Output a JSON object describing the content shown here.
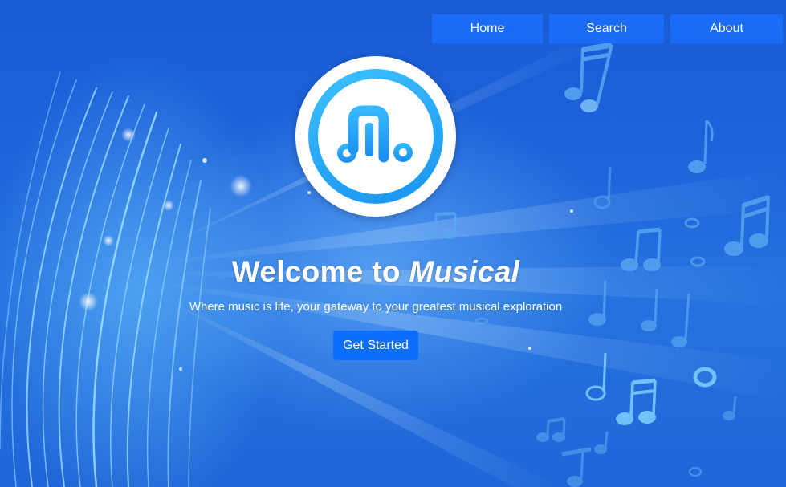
{
  "nav": {
    "items": [
      {
        "label": "Home"
      },
      {
        "label": "Search"
      },
      {
        "label": "About"
      }
    ]
  },
  "hero": {
    "title_prefix": "Welcome to ",
    "title_brand": "Musical",
    "subtitle": "Where music is life, your gateway to your greatest musical exploration",
    "cta_label": "Get Started"
  },
  "logo": {
    "icon": "music-note-icon"
  },
  "colors": {
    "nav_button": "#1a6cf6",
    "cta_button": "#0d6efd",
    "logo_ring": "#29a8f7",
    "background": "#1d63da"
  }
}
